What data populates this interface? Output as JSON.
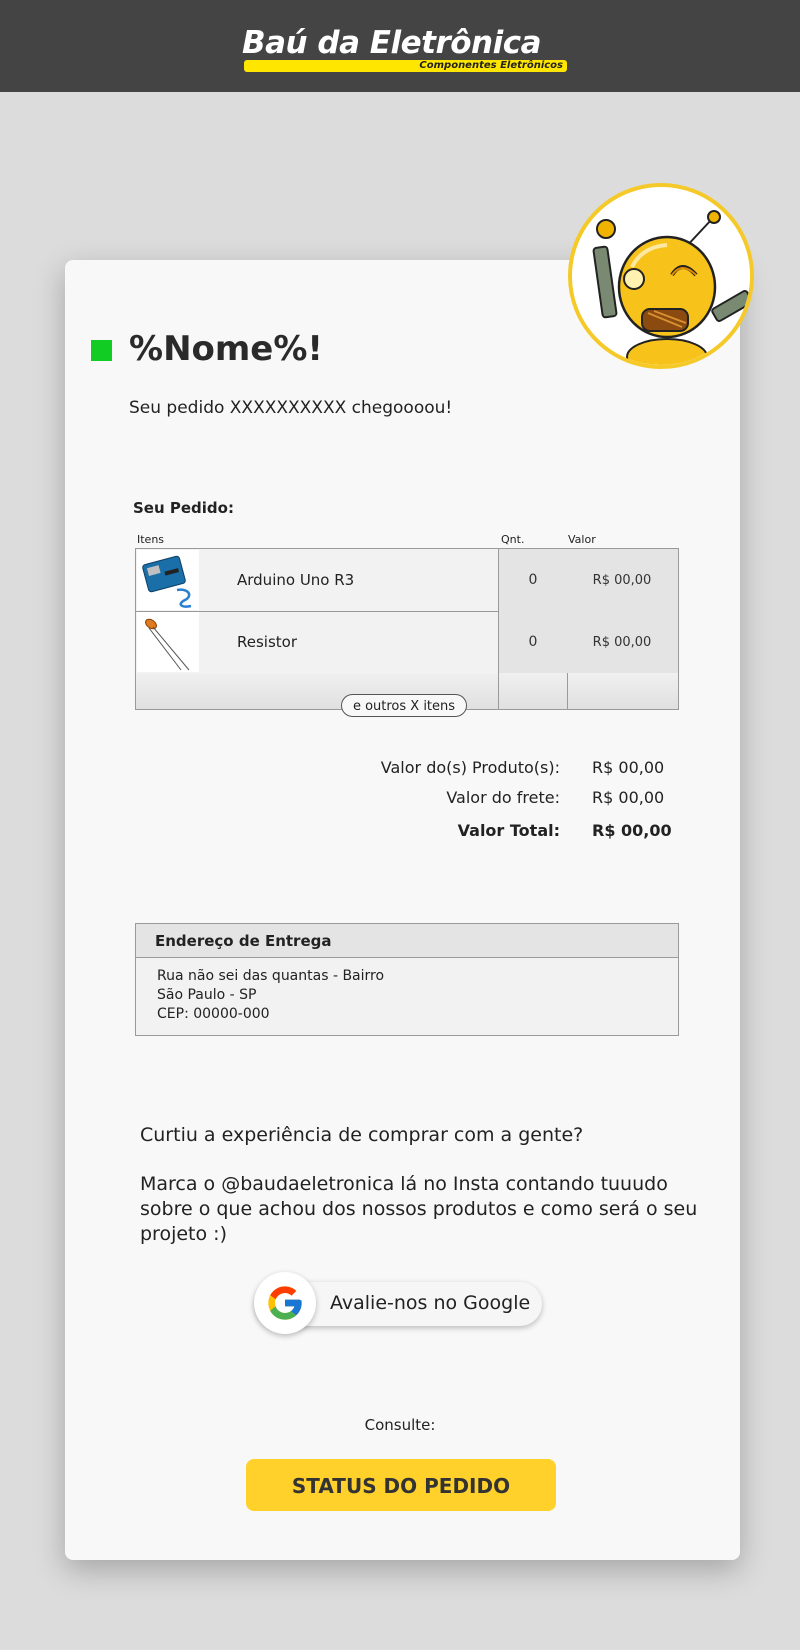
{
  "header": {
    "logo_title": "Baú da Eletrônica",
    "logo_subtitle": "Componentes Eletrônicos",
    "background": "#444444",
    "accent": "#ffe600"
  },
  "greeting": {
    "name": "%Nome%!",
    "message": "Seu pedido XXXXXXXXXX chegoooou!",
    "marker_color": "#11cc22"
  },
  "order": {
    "title": "Seu Pedido:",
    "columns": {
      "items": "Itens",
      "qty": "Qnt.",
      "value": "Valor"
    },
    "rows": [
      {
        "name": "Arduino Uno R3",
        "qty": "0",
        "value": "R$ 00,00",
        "thumb_icon": "arduino-board-icon"
      },
      {
        "name": "Resistor",
        "qty": "0",
        "value": "R$ 00,00",
        "thumb_icon": "resistor-icon"
      }
    ],
    "more_label": "e outros X itens"
  },
  "summary": {
    "products_label": "Valor do(s) Produto(s):",
    "products_value": "R$ 00,00",
    "shipping_label": "Valor do frete:",
    "shipping_value": "R$ 00,00",
    "total_label": "Valor Total:",
    "total_value": "R$ 00,00"
  },
  "address": {
    "title": "Endereço de Entrega",
    "line1": "Rua não sei das quantas - Bairro",
    "line2": "São Paulo - SP",
    "line3": "CEP: 00000-000"
  },
  "promo": {
    "question": "Curtiu a experiência de comprar com a gente?",
    "text": "Marca o @baudaeletronica lá no Insta contando tuuudo sobre o que achou dos nossos produtos e como será o seu projeto :)"
  },
  "google_review": {
    "label": "Avalie-nos no Google",
    "icon": "google-icon"
  },
  "status": {
    "consult_label": "Consulte:",
    "button_label": "STATUS DO PEDIDO",
    "button_color": "#ffd12a"
  }
}
